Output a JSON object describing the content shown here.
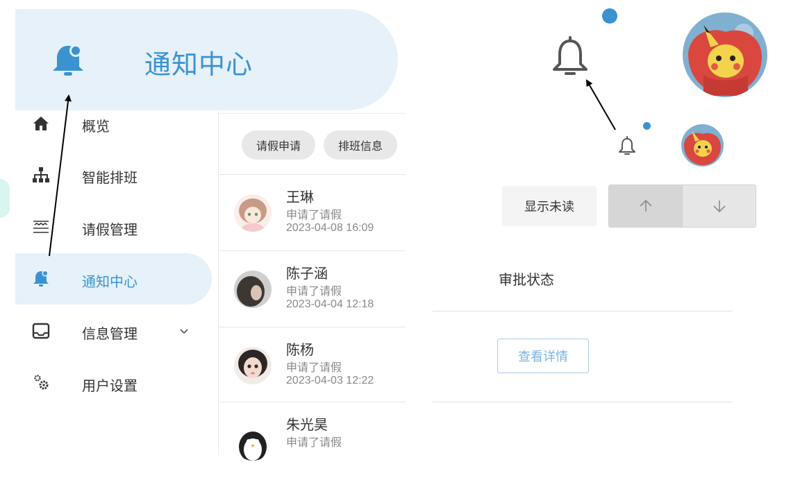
{
  "header": {
    "title": "通知中心"
  },
  "sidebar": {
    "items": [
      {
        "label": "概览",
        "icon": "home-icon"
      },
      {
        "label": "智能排班",
        "icon": "sitemap-icon"
      },
      {
        "label": "请假管理",
        "icon": "list-icon"
      },
      {
        "label": "通知中心",
        "icon": "bell-notification-icon",
        "active": true
      },
      {
        "label": "信息管理",
        "icon": "inbox-icon",
        "expandable": true
      },
      {
        "label": "用户设置",
        "icon": "gears-icon"
      }
    ]
  },
  "filters": {
    "chips": [
      "请假申请",
      "排班信息"
    ]
  },
  "messages": [
    {
      "name": "王琳",
      "action": "申请了请假",
      "time": "2023-04-08 16:09"
    },
    {
      "name": "陈子涵",
      "action": "申请了请假",
      "time": "2023-04-04 12:18"
    },
    {
      "name": "陈杨",
      "action": "申请了请假",
      "time": "2023-04-03 12:22"
    },
    {
      "name": "朱光昊",
      "action": "申请了请假",
      "time": ""
    }
  ],
  "controls": {
    "show_unread": "显示未读"
  },
  "detail": {
    "approval_label": "审批状态",
    "view_details": "查看详情"
  },
  "colors": {
    "accent": "#3a93d0",
    "highlight_bg": "#e6f1f9",
    "chip_bg": "#e8e8e8"
  }
}
